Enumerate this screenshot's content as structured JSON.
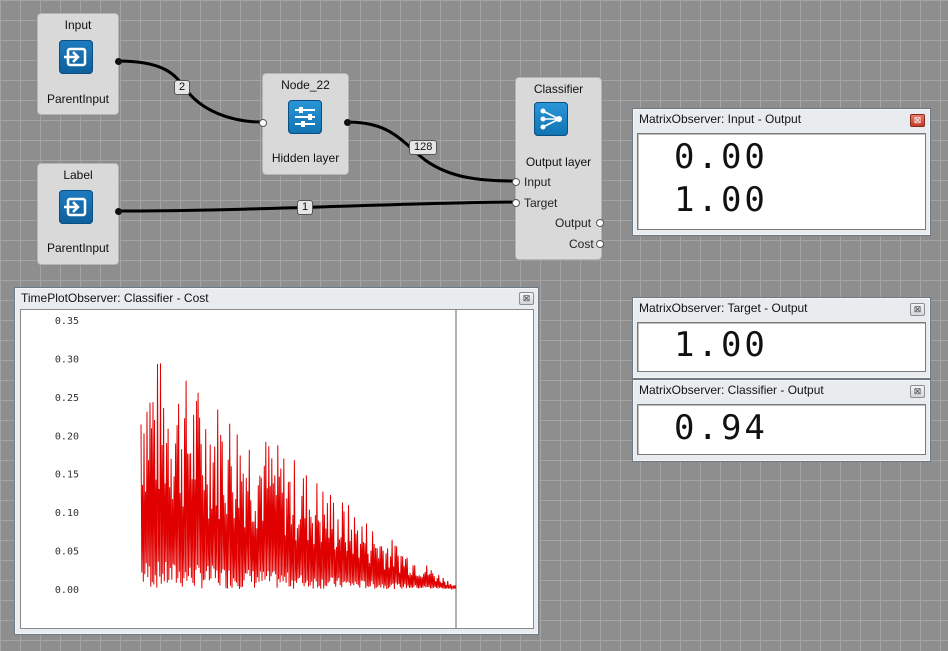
{
  "nodes": {
    "input": {
      "title": "Input",
      "subtitle": "ParentInput",
      "icon": "input-arrow-icon"
    },
    "label": {
      "title": "Label",
      "subtitle": "ParentInput",
      "icon": "input-arrow-icon"
    },
    "node22": {
      "title": "Node_22",
      "subtitle": "Hidden layer",
      "icon": "sliders-icon"
    },
    "classifier": {
      "title": "Classifier",
      "subtitle": "Output layer",
      "icon": "network-icon",
      "ports": {
        "input": "Input",
        "target": "Target",
        "output": "Output",
        "cost": "Cost"
      }
    }
  },
  "edges": {
    "input_to_hidden": "2",
    "hidden_to_classifier": "128",
    "label_to_target": "1"
  },
  "windows": {
    "input_output": {
      "title": "MatrixObserver: Input - Output",
      "values": [
        "0.00",
        "1.00"
      ]
    },
    "target_output": {
      "title": "MatrixObserver: Target - Output",
      "values": [
        "1.00"
      ]
    },
    "classifier_output": {
      "title": "MatrixObserver: Classifier - Output",
      "values": [
        "0.94"
      ]
    },
    "cost_plot": {
      "title": "TimePlotObserver: Classifier - Cost"
    }
  },
  "close_glyph": "⊠",
  "chart_data": {
    "type": "line",
    "ylim": [
      0,
      0.35
    ],
    "y_ticks": [
      "0.35",
      "0.30",
      "0.25",
      "0.20",
      "0.15",
      "0.10",
      "0.05",
      "0.00"
    ],
    "grid": false,
    "series": [
      {
        "color": "#e00000",
        "envelope": {
          "x_start": 0.0,
          "x_end": 1.0,
          "peak_start": 0.32,
          "peak_mid": 0.22,
          "peak_late": 0.08,
          "peak_end": 0.005
        }
      }
    ]
  },
  "colors": {
    "canvas": "#8e8e8e",
    "node": "#d9d9d9",
    "icon": "#1570b0",
    "plot_line": "#e00000"
  }
}
